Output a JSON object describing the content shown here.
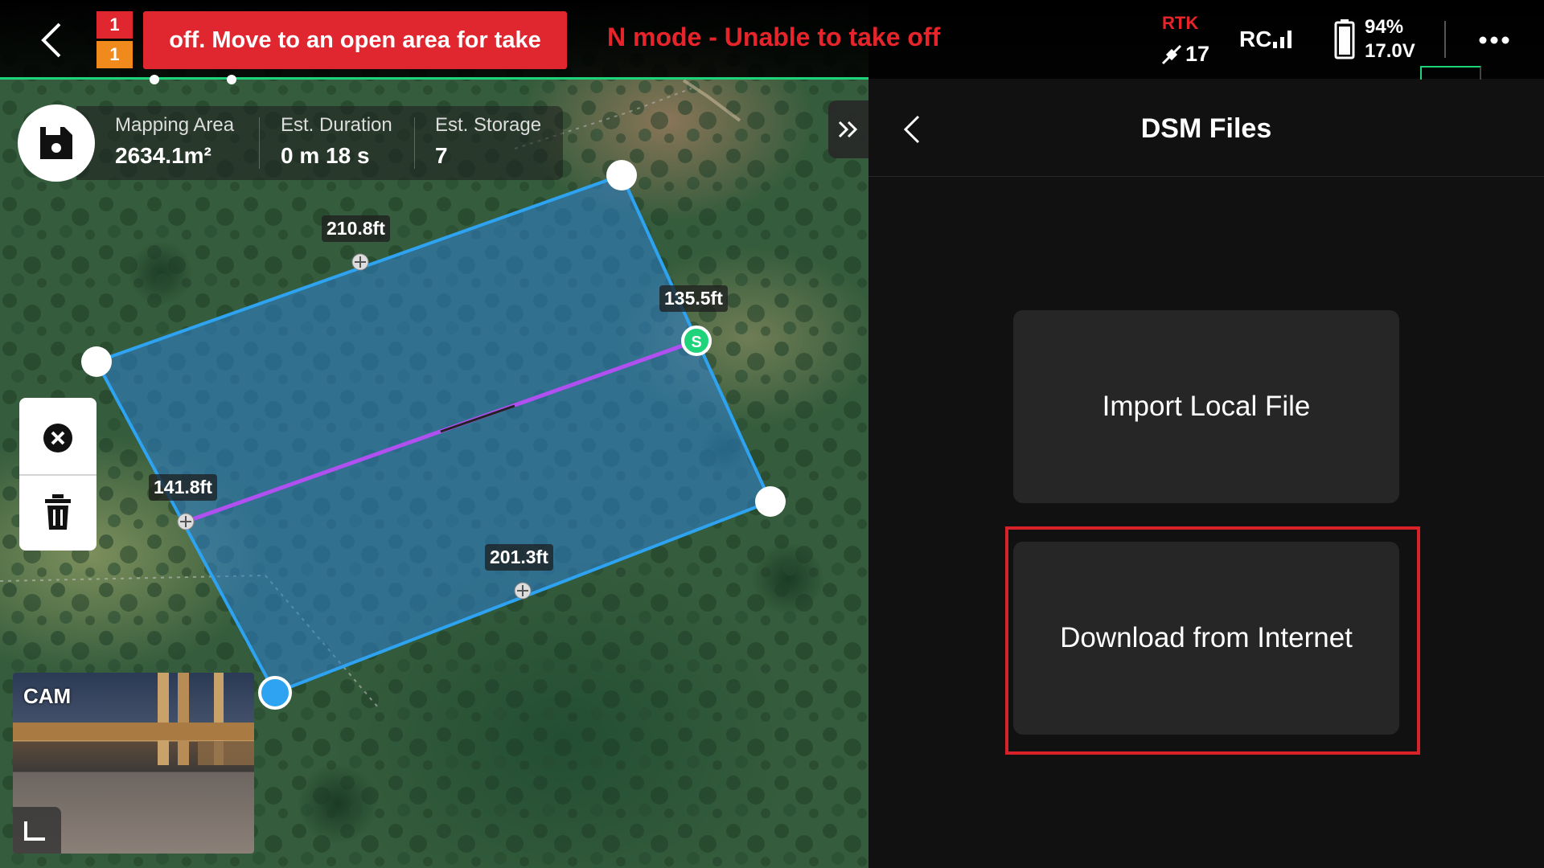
{
  "top_bar": {
    "warning_badge_top": "1",
    "warning_badge_bottom": "1",
    "warning_message": "off. Move to an open area for take",
    "status_warning": "N mode - Unable to take off",
    "rtk_label": "RTK",
    "satellite_count": "17",
    "rc_label": "RC",
    "battery_percent": "94%",
    "battery_voltage": "17.0V",
    "accent_color": "#1ed37a",
    "warning_color": "#e0262e"
  },
  "mapping_stats": [
    {
      "label": "Mapping Area",
      "value": "2634.1m²"
    },
    {
      "label": "Est. Duration",
      "value": "0 m 18 s"
    },
    {
      "label": "Est. Storage",
      "value": "7"
    }
  ],
  "map": {
    "edge_labels": [
      "210.8ft",
      "135.5ft",
      "141.8ft",
      "201.3ft"
    ],
    "start_marker": "S",
    "polygon_color": "#2ea3f2",
    "route_color": "#b050f0"
  },
  "camera": {
    "label": "CAM"
  },
  "icons": {
    "back": "chevron-left-icon",
    "save": "save-icon",
    "expand": "double-chevron-right-icon",
    "close": "close-circle-icon",
    "delete": "trash-icon",
    "more": "more-dots-icon",
    "satellite": "satellite-icon",
    "battery": "battery-icon",
    "camera_swap": "corner-swap-icon"
  },
  "panel": {
    "title": "DSM Files",
    "import_label": "Import Local File",
    "download_label": "Download from Internet"
  }
}
